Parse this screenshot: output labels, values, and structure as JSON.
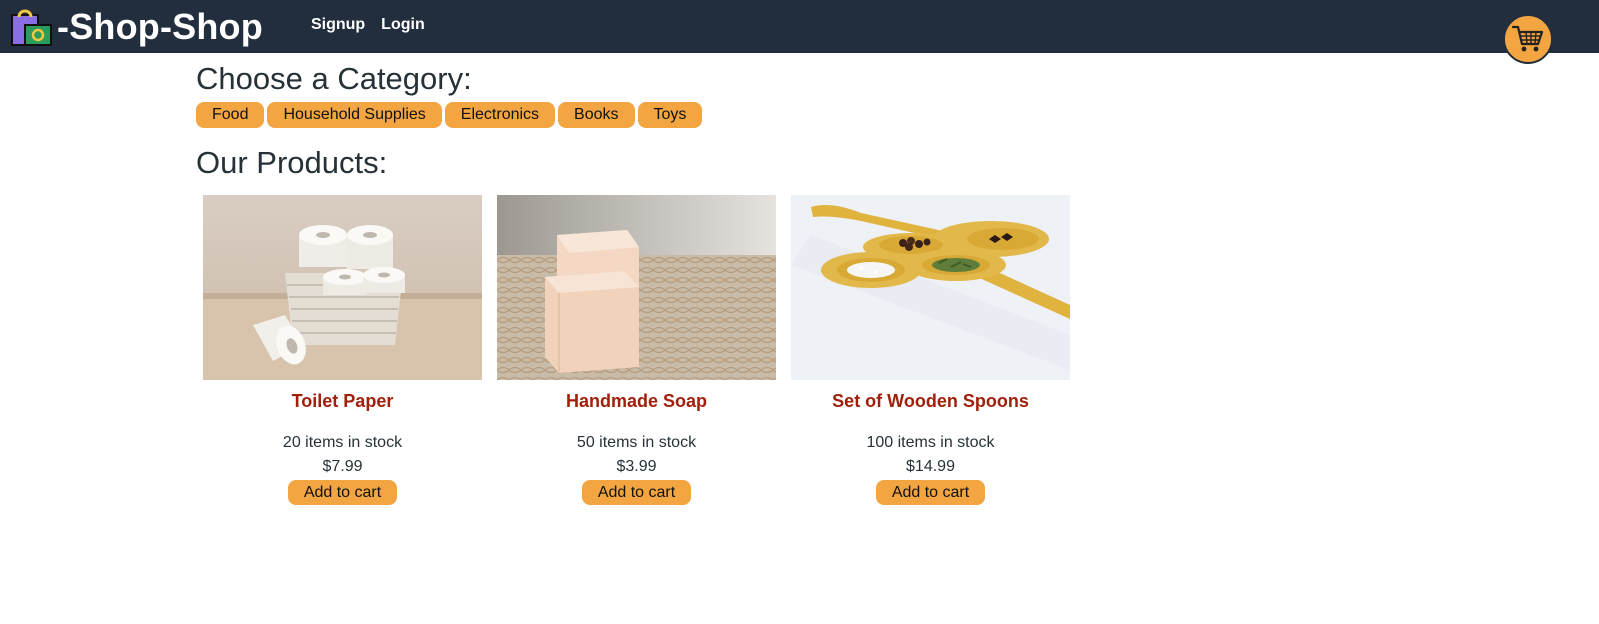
{
  "header": {
    "brand": "-Shop-Shop",
    "logo_icon": "shopping-bags-icon",
    "nav": [
      "Signup",
      "Login"
    ],
    "cart_icon": "shopping-cart-icon"
  },
  "categories": {
    "title": "Choose a Category:",
    "items": [
      "Food",
      "Household Supplies",
      "Electronics",
      "Books",
      "Toys"
    ]
  },
  "products": {
    "title": "Our Products:",
    "items": [
      {
        "name": "Toilet Paper",
        "stock": "20 items in stock",
        "price": "$7.99",
        "button": "Add to cart"
      },
      {
        "name": "Handmade Soap",
        "stock": "50 items in stock",
        "price": "$3.99",
        "button": "Add to cart"
      },
      {
        "name": "Set of Wooden Spoons",
        "stock": "100 items in stock",
        "price": "$14.99",
        "button": "Add to cart"
      }
    ]
  },
  "colors": {
    "navbar": "#222e3d",
    "accent": "#f2a541",
    "product_name": "#a0200c",
    "text": "#263238"
  }
}
